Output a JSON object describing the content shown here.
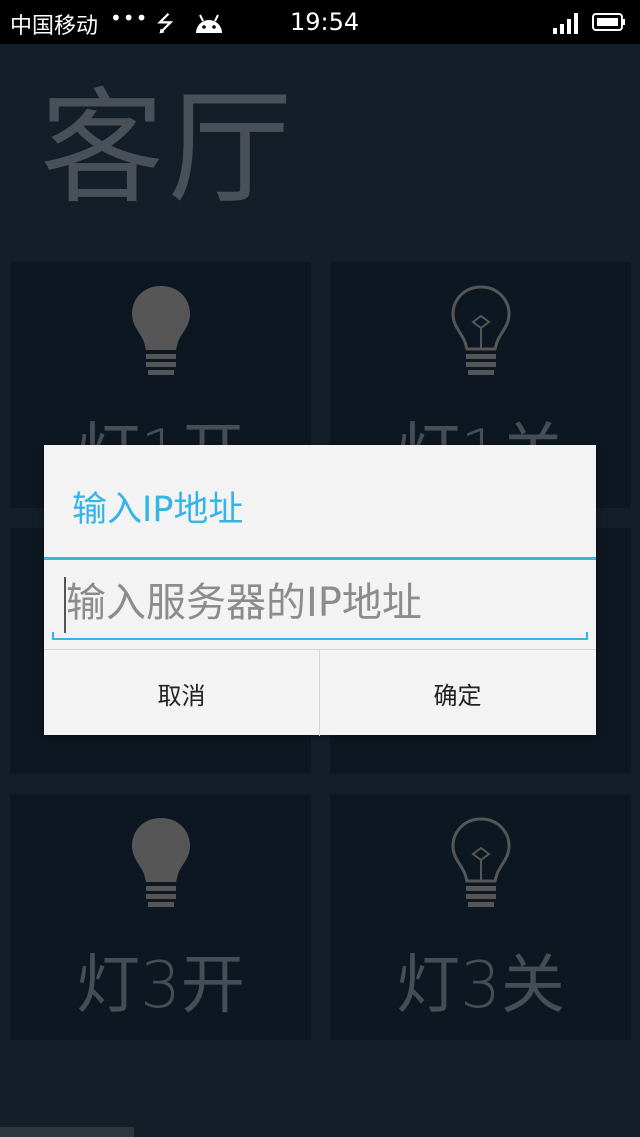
{
  "status_bar": {
    "carrier": "中国移动",
    "dots": "•••",
    "time": "19:54"
  },
  "screen": {
    "title": "客厅",
    "tiles": [
      {
        "label": "灯1开",
        "icon": "bulb-filled-icon"
      },
      {
        "label": "灯1关",
        "icon": "bulb-outline-icon"
      },
      {
        "label": "",
        "icon": "bulb-filled-icon"
      },
      {
        "label": "",
        "icon": "bulb-outline-icon"
      },
      {
        "label": "灯3开",
        "icon": "bulb-filled-icon"
      },
      {
        "label": "灯3关",
        "icon": "bulb-outline-icon"
      }
    ]
  },
  "dialog": {
    "title": "输入IP地址",
    "input_value": "",
    "input_placeholder": "输入服务器的IP地址",
    "cancel_label": "取消",
    "ok_label": "确定"
  },
  "colors": {
    "accent": "#33b5e5",
    "app_background": "#1d2d3d",
    "tile_background": "#142331",
    "dialog_background": "#f3f3f3"
  }
}
